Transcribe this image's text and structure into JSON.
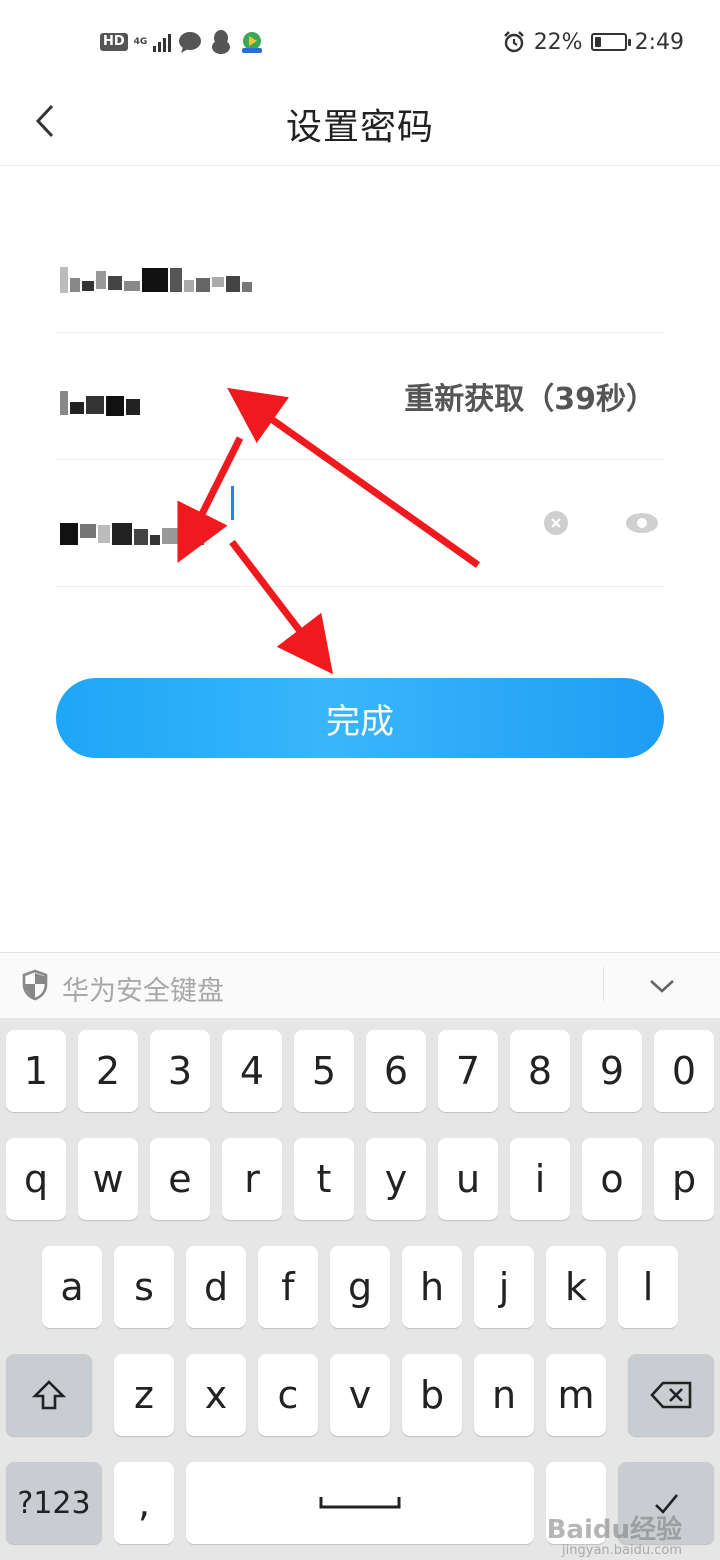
{
  "status_bar": {
    "hd": "HD",
    "network": "4G",
    "battery_percent": "22%",
    "battery_level": 0.22,
    "time": "2:49"
  },
  "header": {
    "title": "设置密码"
  },
  "form": {
    "resend_label": "重新获取（39秒）"
  },
  "done_button": {
    "label": "完成"
  },
  "keyboard": {
    "title": "华为安全键盘",
    "row1": [
      "1",
      "2",
      "3",
      "4",
      "5",
      "6",
      "7",
      "8",
      "9",
      "0"
    ],
    "row2": [
      "q",
      "w",
      "e",
      "r",
      "t",
      "y",
      "u",
      "i",
      "o",
      "p"
    ],
    "row3": [
      "a",
      "s",
      "d",
      "f",
      "g",
      "h",
      "j",
      "k",
      "l"
    ],
    "row4": [
      "z",
      "x",
      "c",
      "v",
      "b",
      "n",
      "m"
    ],
    "symbols_label": "?123",
    "comma_label": ","
  },
  "watermark": {
    "brand": "Baidu经验",
    "url": "jingyan.baidu.com"
  },
  "colors": {
    "accent": "#1ea6f7",
    "annotation": "#f0191e"
  }
}
